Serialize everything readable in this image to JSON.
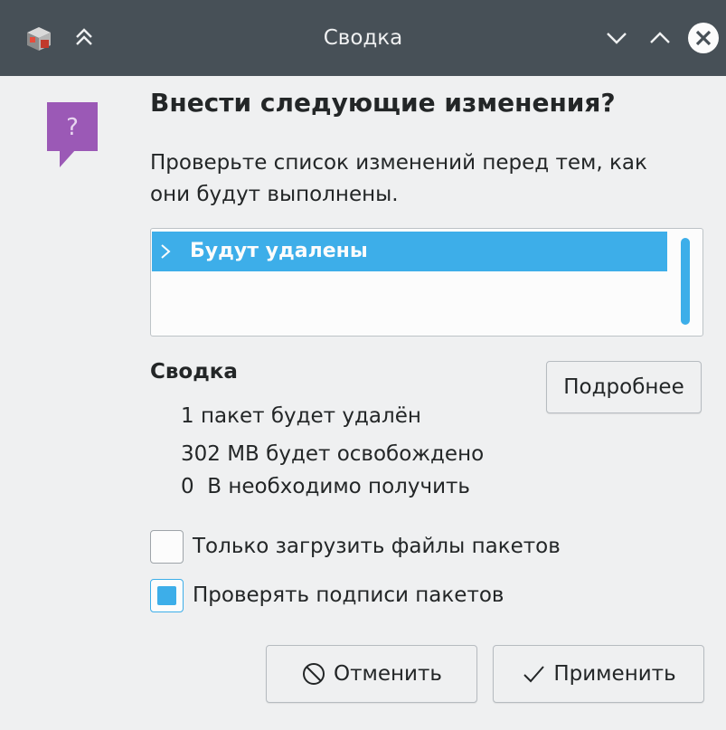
{
  "window": {
    "title": "Сводка",
    "app_icon": "package-manager-icon",
    "keep_above_icon": "keep-above-icon",
    "minimize_icon": "chevron-down-icon",
    "maximize_icon": "chevron-up-icon",
    "close_icon": "close-icon"
  },
  "dialog": {
    "icon": "question-icon",
    "heading": "Внести следующие изменения?",
    "description": "Проверьте список изменений перед тем, как они будут выполнены."
  },
  "changes_list": {
    "items": [
      {
        "label": "Будут удалены",
        "selected": true,
        "expanded": false
      }
    ]
  },
  "summary": {
    "title": "Сводка",
    "details_button": "Подробнее",
    "lines": [
      "1 пакет будет удалён",
      "302 MB будет освобождено",
      "0  B необходимо получить"
    ]
  },
  "options": {
    "download_only": {
      "label": "Только загрузить файлы пакетов",
      "checked": false
    },
    "verify_signatures": {
      "label": "Проверять подписи пакетов",
      "checked": true
    }
  },
  "buttons": {
    "cancel": "Отменить",
    "apply": "Применить"
  },
  "colors": {
    "titlebar": "#475057",
    "accent": "#3daee9",
    "window_bg": "#eff0f1",
    "question_icon": "#9b59b6"
  }
}
